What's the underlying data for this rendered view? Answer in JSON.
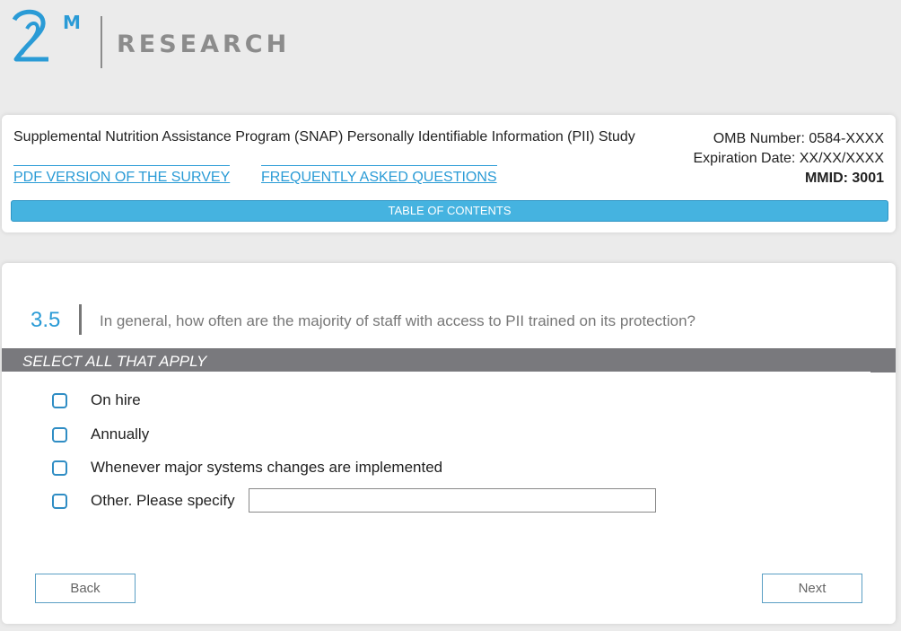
{
  "logo": {
    "mark": "2M",
    "text": "RESEARCH",
    "brand_color": "#2a9bd6"
  },
  "header": {
    "study_title": "Supplemental Nutrition Assistance Program (SNAP) Personally Identifiable Information (PII) Study",
    "omb_number": "OMB Number: 0584-XXXX",
    "expiration": "Expiration Date: XX/XX/XXXX",
    "mmid": "MMID: 3001",
    "links": {
      "pdf": "PDF VERSION OF THE SURVEY",
      "faq": "FREQUENTLY ASKED QUESTIONS"
    },
    "toc_label": "TABLE OF CONTENTS"
  },
  "question": {
    "number": "3.5",
    "text": "In general, how often are the majority of staff with access to PII trained on its protection?",
    "instruction": "SELECT ALL THAT APPLY",
    "options": [
      {
        "label": "On hire",
        "checked": false
      },
      {
        "label": "Annually",
        "checked": false
      },
      {
        "label": "Whenever major systems changes are implemented",
        "checked": false
      },
      {
        "label": "Other. Please specify",
        "checked": false
      }
    ],
    "specify_value": ""
  },
  "nav": {
    "back_label": "Back",
    "next_label": "Next"
  },
  "colors": {
    "accent": "#2a9bd6",
    "toc_bar": "#45b3e0",
    "banner": "#79797d"
  }
}
